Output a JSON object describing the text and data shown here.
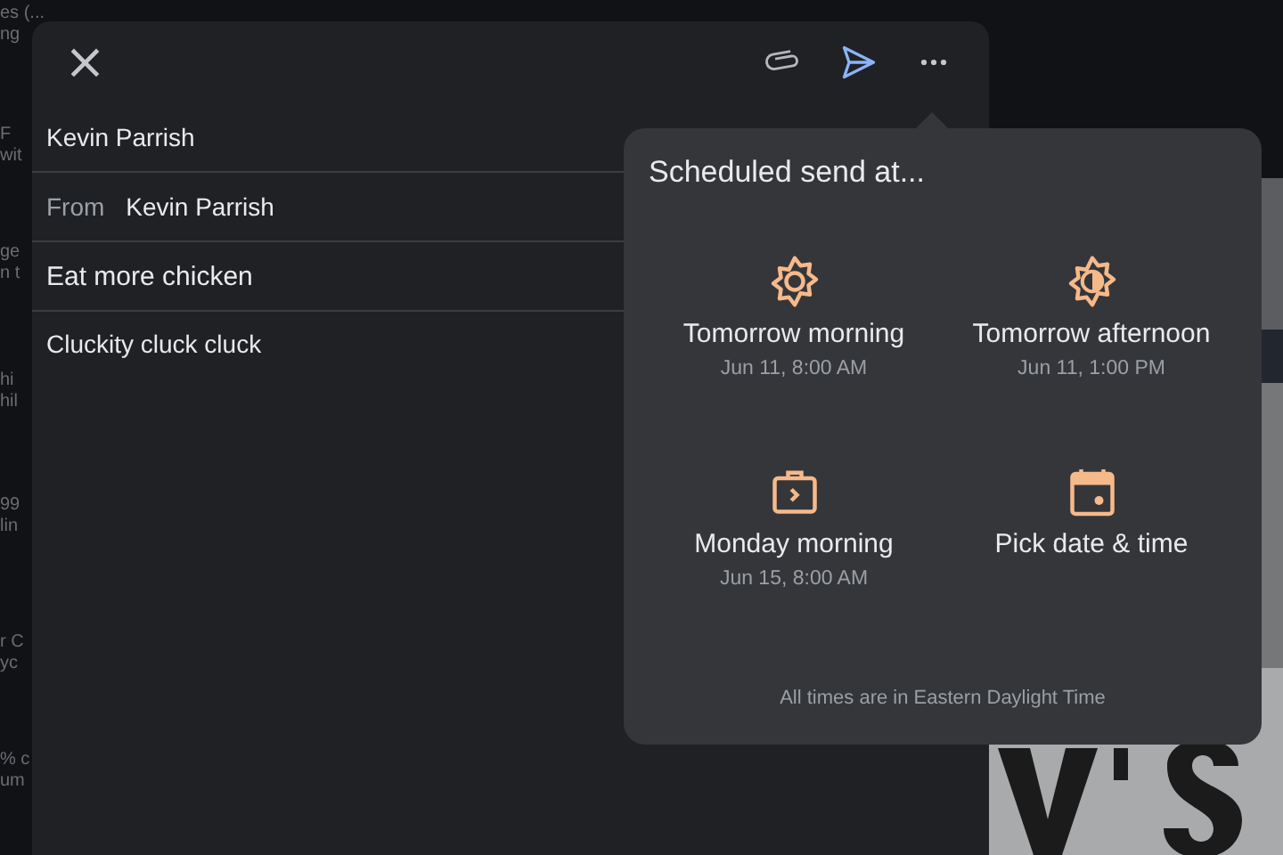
{
  "background": {
    "fragments": [
      "es (...",
      "ng",
      "F",
      "wit",
      "ge",
      "n t",
      "hi",
      "hil",
      "99",
      "lin",
      "r C",
      "yc",
      "% c",
      "um"
    ]
  },
  "compose": {
    "toolbar": {
      "close": "×"
    },
    "to": "Kevin Parrish",
    "from": {
      "label": "From",
      "value": "Kevin Parrish"
    },
    "subject": "Eat more chicken",
    "body": "Cluckity cluck cluck"
  },
  "schedule_popup": {
    "title": "Scheduled send at...",
    "options": [
      {
        "kind": "sun",
        "label": "Tomorrow morning",
        "time": "Jun 11, 8:00 AM"
      },
      {
        "kind": "half-sun",
        "label": "Tomorrow afternoon",
        "time": "Jun 11, 1:00 PM"
      },
      {
        "kind": "briefcase",
        "label": "Monday morning",
        "time": "Jun 15, 8:00 AM"
      },
      {
        "kind": "calendar",
        "label": "Pick date & time"
      }
    ],
    "footer": "All times are in Eastern Daylight Time"
  }
}
